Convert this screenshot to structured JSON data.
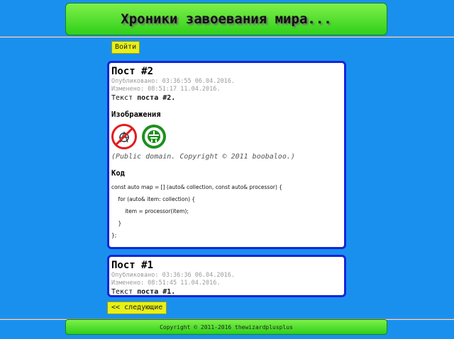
{
  "header": {
    "title": "Хроники завоевания мира..."
  },
  "auth": {
    "login_label": "Войти"
  },
  "posts": [
    {
      "title": "Пост #2",
      "published_label": "Опубликовано: 03:36:55 06.04.2016.",
      "modified_label": "Изменено: 08:51:17 11.04.2016.",
      "text_prefix": "Текст ",
      "text_bold": "поста #2.",
      "images_heading": "Изображения",
      "images": [
        {
          "icon": "crossed-out-logo-icon",
          "color": "#e21b1b"
        },
        {
          "icon": "green-circle-emblem-icon",
          "color": "#1f8f1f"
        }
      ],
      "caption": "(Public domain. Copyright © 2011 boobaloo.)",
      "code_heading": "Код",
      "code_lines": [
        "const auto map = [] (auto& collection, const auto& processor) {",
        "    for (auto& item: collection) {",
        "        item = processor(item);",
        "    }",
        "};"
      ]
    },
    {
      "title": "Пост #1",
      "published_label": "Опубликовано: 03:36:36 06.04.2016.",
      "modified_label": "Изменено: 08:51:45 11.04.2016.",
      "text_prefix": "Текст ",
      "text_bold": "поста #1."
    }
  ],
  "pagination": {
    "next_label": "<< следующие"
  },
  "footer": {
    "copyright": "Copyright © 2011-2016 thewizardplusplus"
  },
  "colors": {
    "background": "#1a90ee",
    "banner": "#3fd420",
    "post_border": "#1525d8",
    "button": "#e8f018"
  }
}
